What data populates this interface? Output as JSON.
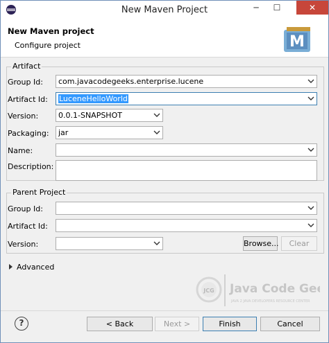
{
  "window": {
    "title": "New Maven Project",
    "controls": {
      "minimize": "─",
      "maximize": "☐",
      "close": "✕"
    }
  },
  "banner": {
    "title": "New Maven project",
    "subtitle": "Configure project",
    "logo_letter": "M"
  },
  "artifact": {
    "group_label": "Artifact",
    "group_id": {
      "label": "Group Id:",
      "value": "com.javacodegeeks.enterprise.lucene"
    },
    "artifact_id": {
      "label": "Artifact Id:",
      "value": "LuceneHelloWorld"
    },
    "version": {
      "label": "Version:",
      "value": "0.0.1-SNAPSHOT"
    },
    "packaging": {
      "label": "Packaging:",
      "value": "jar"
    },
    "name": {
      "label": "Name:",
      "value": ""
    },
    "description": {
      "label": "Description:",
      "value": ""
    }
  },
  "parent": {
    "group_label": "Parent Project",
    "group_id": {
      "label": "Group Id:",
      "value": ""
    },
    "artifact_id": {
      "label": "Artifact Id:",
      "value": ""
    },
    "version": {
      "label": "Version:",
      "value": ""
    },
    "browse_label": "Browse...",
    "clear_label": "Clear"
  },
  "advanced_label": "Advanced",
  "watermark": {
    "logo_text": "JCG",
    "brand": "Java Code Geeks",
    "tagline": "JAVA 2 JAVA DEVELOPERS RESOURCE CENTER"
  },
  "footer": {
    "help_symbol": "?",
    "back_label": "< Back",
    "next_label": "Next >",
    "finish_label": "Finish",
    "cancel_label": "Cancel"
  },
  "colors": {
    "focus_border": "#3c7fb1",
    "selection": "#3399ff",
    "close_button": "#c7463a"
  }
}
